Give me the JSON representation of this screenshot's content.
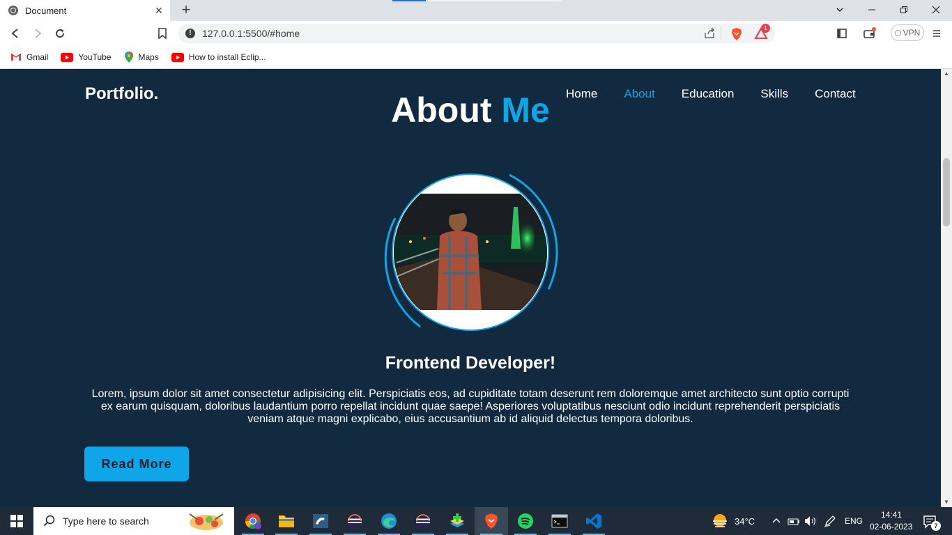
{
  "browser": {
    "tab_title": "Document",
    "url": "127.0.0.1:5500/#home",
    "vpn_label": "VPN",
    "alerts_badge": "1",
    "bookmarks": [
      {
        "label": "Gmail",
        "icon": "gmail-icon"
      },
      {
        "label": "YouTube",
        "icon": "youtube-icon"
      },
      {
        "label": "Maps",
        "icon": "maps-icon"
      },
      {
        "label": "How to install Eclip...",
        "icon": "youtube-icon"
      }
    ]
  },
  "site": {
    "logo": "Portfolio.",
    "nav": [
      "Home",
      "About",
      "Education",
      "Skills",
      "Contact"
    ],
    "active_nav": "About",
    "heading_main": "About ",
    "heading_accent": "Me",
    "subtitle": "Frontend Developer!",
    "paragraph": "Lorem, ipsum dolor sit amet consectetur adipisicing elit. Perspiciatis eos, ad cupiditate totam deserunt rem doloremque amet architecto sunt optio corrupti ex earum quisquam, doloribus laudantium porro repellat incidunt quae saepe! Asperiores voluptatibus nesciunt odio incidunt reprehenderit perspiciatis veniam atque magni explicabo, eius accusantium ab id aliquid delectus tempora doloribus.",
    "button": "Read More",
    "colors": {
      "background": "#112a3f",
      "accent": "#0ea5e9",
      "text": "#ffffff"
    }
  },
  "taskbar": {
    "search_placeholder": "Type here to search",
    "weather": "34°C",
    "language": "ENG",
    "time": "14:41",
    "date": "02-06-2023",
    "notification_count": "7"
  }
}
